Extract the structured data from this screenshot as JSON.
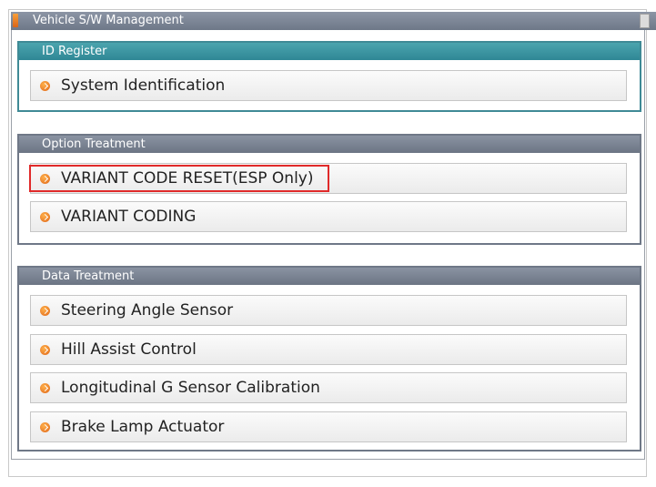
{
  "window": {
    "title": "Vehicle S/W Management"
  },
  "groups": {
    "id_register": {
      "header": "ID Register",
      "items": [
        "System Identification"
      ]
    },
    "option_treatment": {
      "header": "Option Treatment",
      "items": [
        "VARIANT CODE RESET(ESP Only)",
        "VARIANT CODING"
      ]
    },
    "data_treatment": {
      "header": "Data Treatment",
      "items": [
        "Steering Angle Sensor",
        "Hill Assist Control",
        "Longitudinal G Sensor Calibration",
        "Brake Lamp Actuator"
      ]
    }
  },
  "icons": {
    "bullet": "arrow-circle-icon",
    "title": "window-title-icon"
  },
  "colors": {
    "id_header": "#2f8795",
    "section_header": "#6c7584",
    "bullet": "#e0661a",
    "highlight": "#e02a2a"
  }
}
